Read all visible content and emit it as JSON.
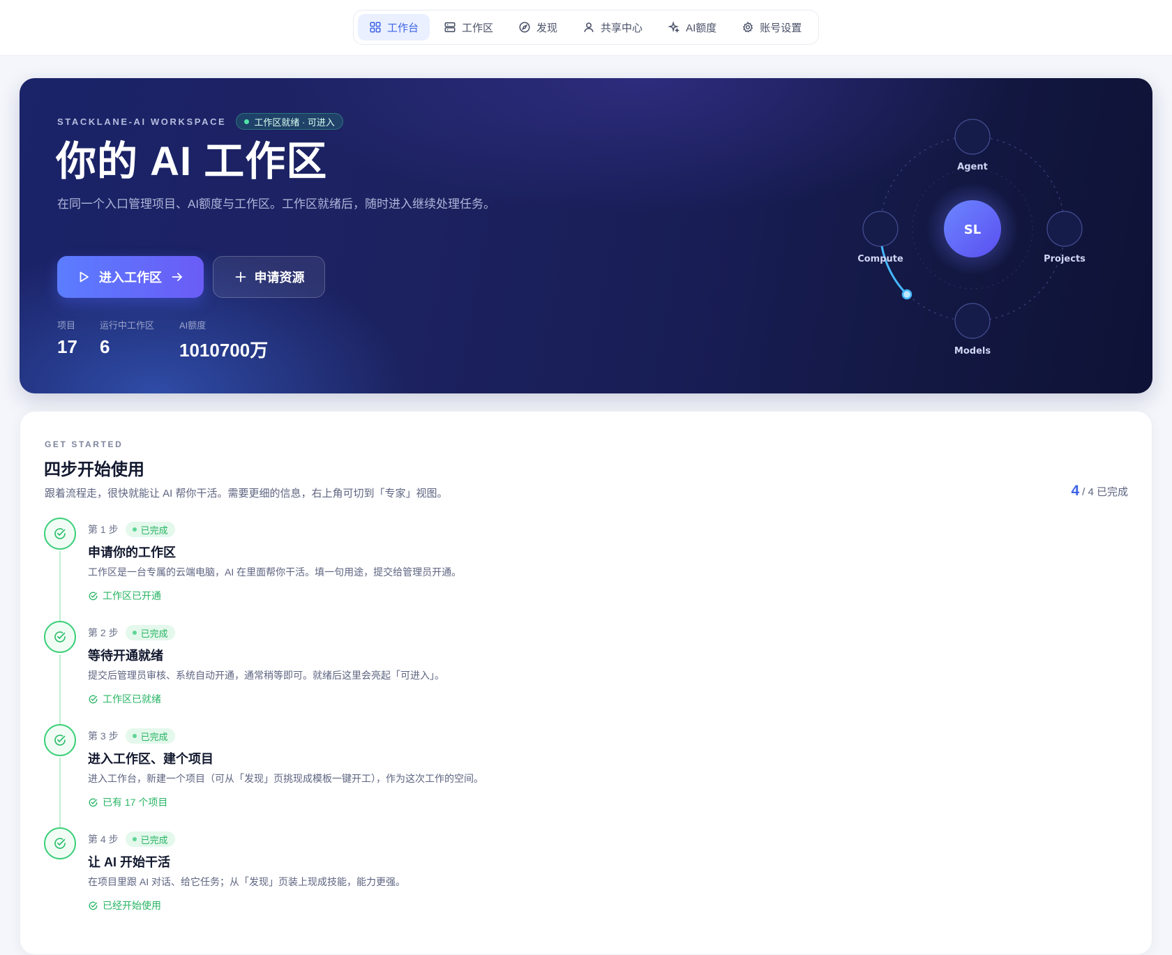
{
  "nav": {
    "items": [
      {
        "label": "工作台",
        "icon": "grid-icon",
        "active": true
      },
      {
        "label": "工作区",
        "icon": "server-icon",
        "active": false
      },
      {
        "label": "发现",
        "icon": "compass-icon",
        "active": false
      },
      {
        "label": "共享中心",
        "icon": "user-icon",
        "active": false
      },
      {
        "label": "AI额度",
        "icon": "sparkle-icon",
        "active": false
      },
      {
        "label": "账号设置",
        "icon": "gear-icon",
        "active": false
      }
    ]
  },
  "hero": {
    "eyebrow": "STACKLANE-AI WORKSPACE",
    "status": "工作区就绪 · 可进入",
    "title": "你的 AI 工作区",
    "description": "在同一个入口管理项目、AI额度与工作区。工作区就绪后，随时进入继续处理任务。",
    "primary_button": "进入工作区",
    "secondary_button": "申请资源",
    "stats": [
      {
        "label": "项目",
        "value": "17"
      },
      {
        "label": "运行中工作区",
        "value": "6"
      },
      {
        "label": "AI额度",
        "value": "1010700万"
      }
    ],
    "orbit": {
      "center": "SL",
      "nodes": [
        "Agent",
        "Projects",
        "Models",
        "Compute"
      ]
    }
  },
  "onboarding": {
    "eyebrow": "GET STARTED",
    "title": "四步开始使用",
    "description": "跟着流程走，很快就能让 AI 帮你干活。需要更细的信息，右上角可切到「专家」视图。",
    "progress_done": "4",
    "progress_total": "/ 4 已完成",
    "steps": [
      {
        "num": "第 1 步",
        "badge": "已完成",
        "title": "申请你的工作区",
        "desc": "工作区是一台专属的云端电脑，AI 在里面帮你干活。填一句用途，提交给管理员开通。",
        "result": "工作区已开通"
      },
      {
        "num": "第 2 步",
        "badge": "已完成",
        "title": "等待开通就绪",
        "desc": "提交后管理员审核、系统自动开通，通常稍等即可。就绪后这里会亮起「可进入」。",
        "result": "工作区已就绪"
      },
      {
        "num": "第 3 步",
        "badge": "已完成",
        "title": "进入工作区、建个项目",
        "desc": "进入工作台，新建一个项目（可从「发现」页挑现成模板一键开工），作为这次工作的空间。",
        "result": "已有 17 个项目"
      },
      {
        "num": "第 4 步",
        "badge": "已完成",
        "title": "让 AI 开始干活",
        "desc": "在项目里跟 AI 对话、给它任务；从「发现」页装上现成技能，能力更强。",
        "result": "已经开始使用"
      }
    ]
  },
  "colors": {
    "accent": "#3d63e8",
    "success": "#27b463",
    "hero_bg": "#1b2369"
  }
}
